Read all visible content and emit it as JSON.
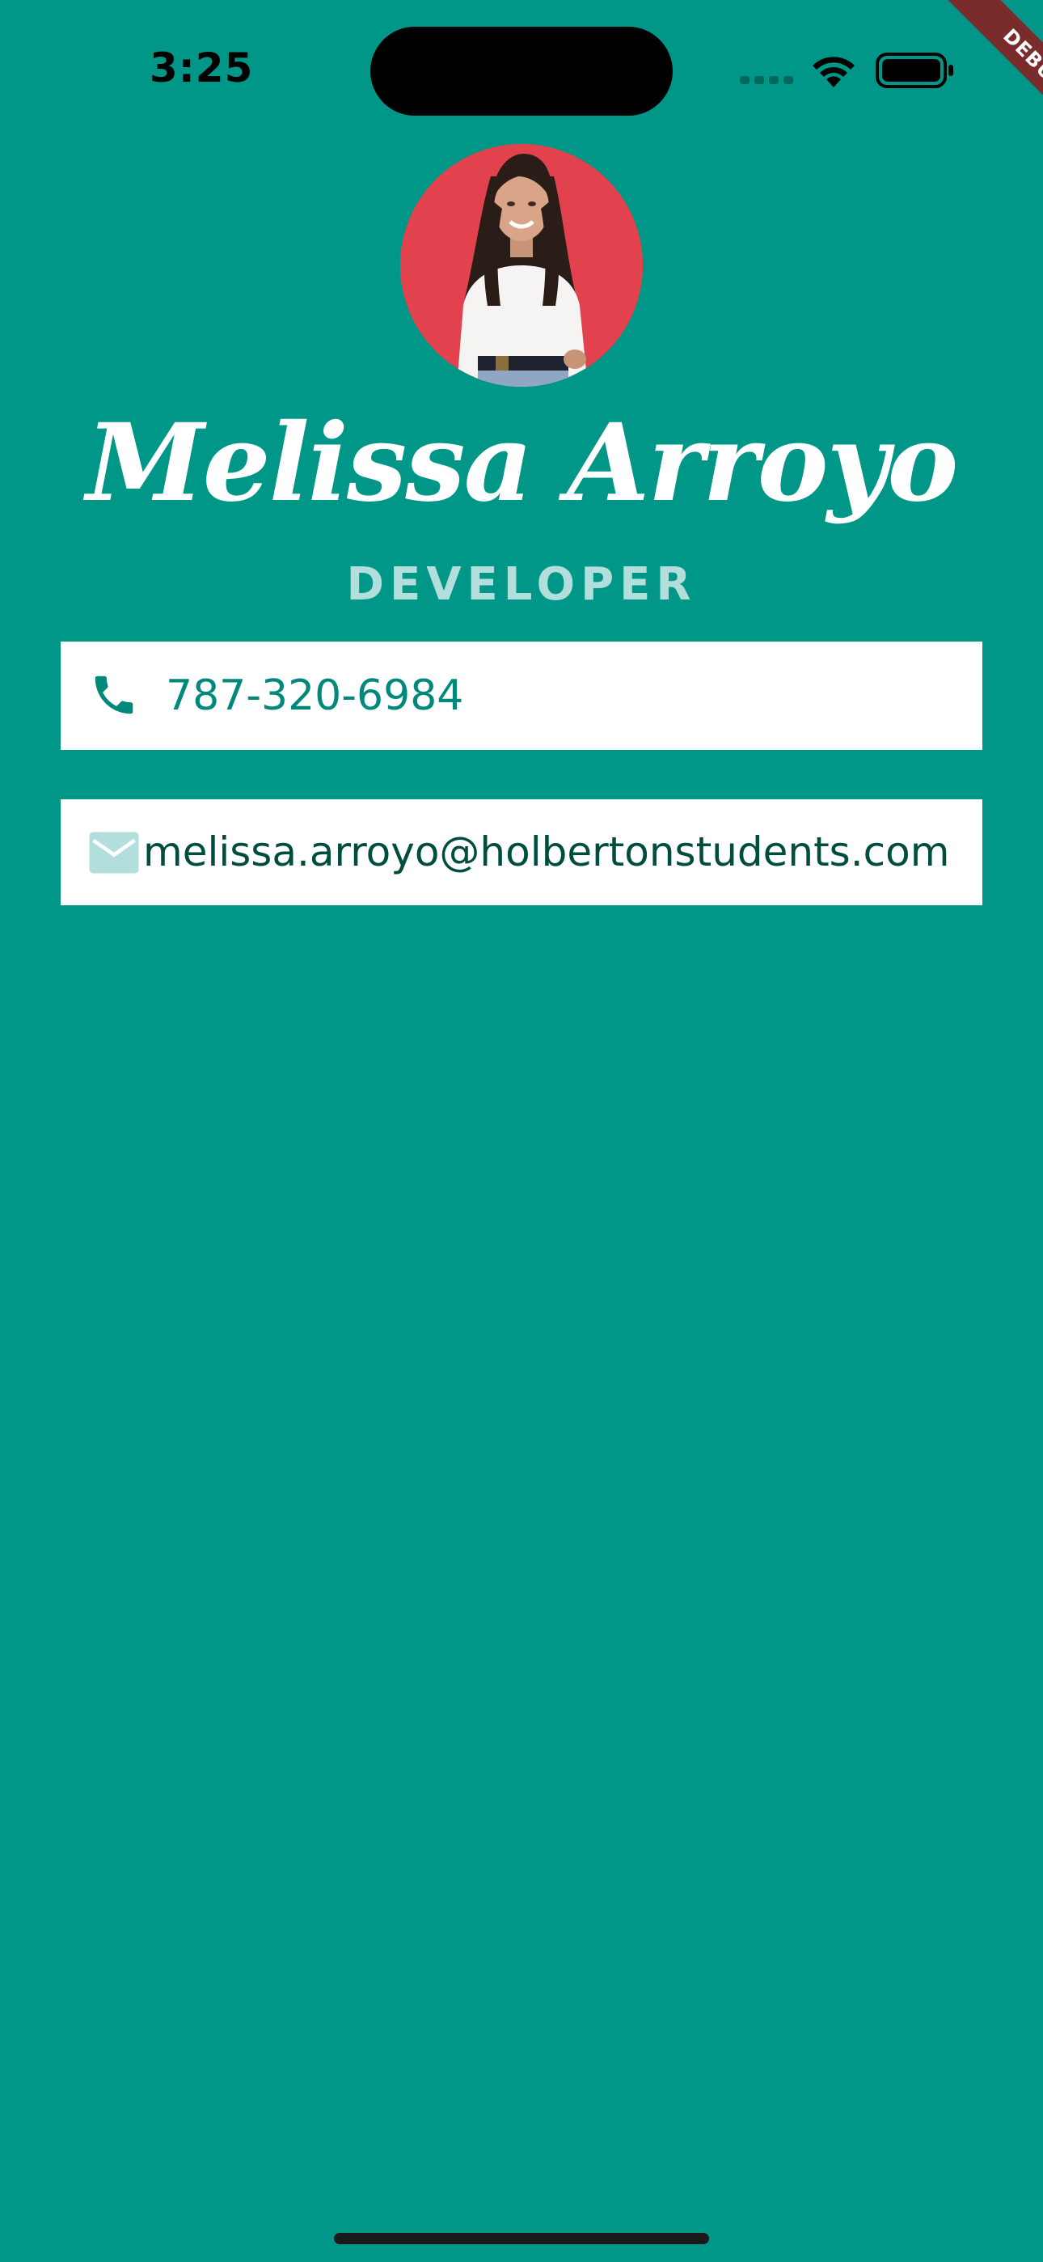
{
  "status_bar": {
    "time": "3:25"
  },
  "debug_banner": "DEBUG",
  "profile": {
    "name": "Melissa Arroyo",
    "title": "DEVELOPER"
  },
  "contacts": {
    "phone": "787-320-6984",
    "email": "melissa.arroyo@holbertonstudents.com"
  },
  "icons": {
    "phone": "phone-icon",
    "email": "mail-icon",
    "wifi": "wifi-icon",
    "battery": "battery-icon",
    "signal": "signal-icon"
  },
  "colors": {
    "background": "#009688",
    "card": "#ffffff",
    "phone_text": "#00897b",
    "email_text": "#004d40",
    "title_text": "#b2dfdb",
    "mail_icon": "#b2dfdb",
    "debug_ribbon": "#7a2c2c"
  }
}
